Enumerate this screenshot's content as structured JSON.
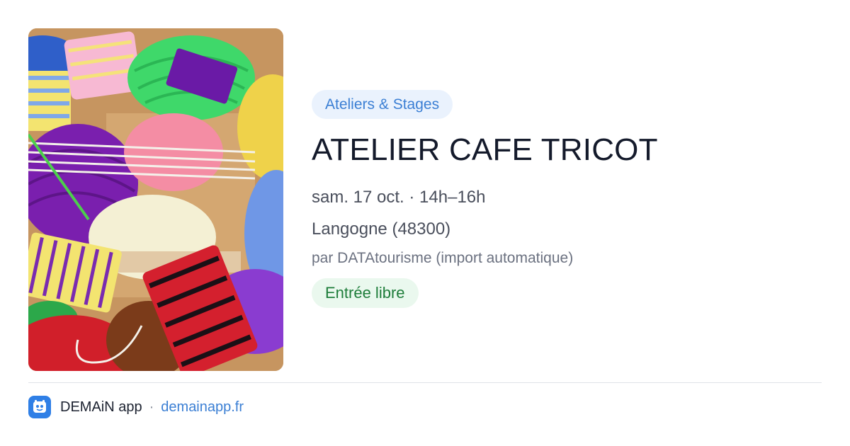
{
  "event": {
    "category": "Ateliers & Stages",
    "title": "ATELIER CAFE TRICOT",
    "datetime": "sam. 17 oct. · 14h–16h",
    "place": "Langogne (48300)",
    "source": "par DATAtourisme (import automatique)",
    "price": "Entrée libre"
  },
  "footer": {
    "app_name": "DEMAiN app",
    "separator": "·",
    "link": "demainapp.fr"
  },
  "colors": {
    "category_bg": "#eaf2fd",
    "category_text": "#3b7fd4",
    "price_bg": "#eaf8ee",
    "price_text": "#1e7d3a",
    "link": "#3b7fd4"
  },
  "icons": {
    "app": "demain-app-icon"
  }
}
